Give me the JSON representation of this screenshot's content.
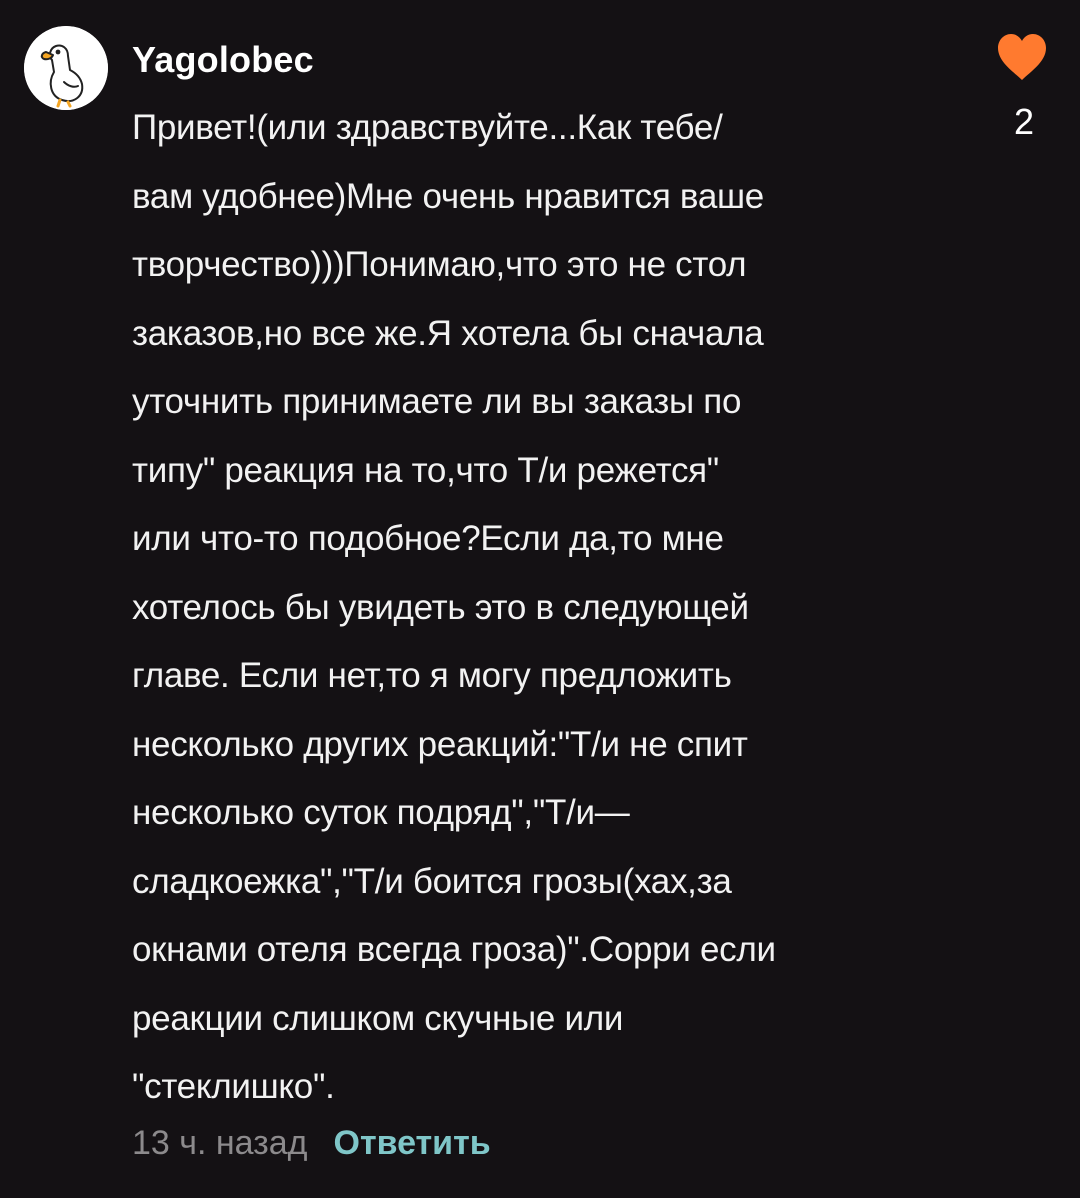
{
  "comment": {
    "author": "Yagolobec",
    "text": "Привет!(или здравствуйте...Как тебе/\nвам удобнее)Мне очень нравится ваше\nтворчество)))Понимаю,что это не стол\nзаказов,но все же.Я хотела бы сначала\nуточнить принимаете ли вы заказы по\nтипу\"  реакция на то,что Т/и  режется\"\nили что-то подобное?Если да,то мне\nхотелось бы увидеть это в следующей\nглаве. Если нет,то я могу предложить\nнесколько других реакций:\"Т/и не спит\nнесколько суток подряд\",\"Т/и—\nсладкоежка\",\"Т/и  боится грозы(хах,за\nокнами отеля всегда гроза)\".Сорри если\nреакции слишком скучные или\n\"стеклишко\".",
    "like_count": "2",
    "timestamp": "13 ч. назад",
    "reply_label": "Ответить"
  },
  "icons": {
    "avatar": "goose-avatar",
    "like": "heart-icon"
  },
  "colors": {
    "background": "#141114",
    "heart": "#ff7a2f",
    "reply": "#7fc6c8",
    "timestamp": "#8c8a8c"
  }
}
